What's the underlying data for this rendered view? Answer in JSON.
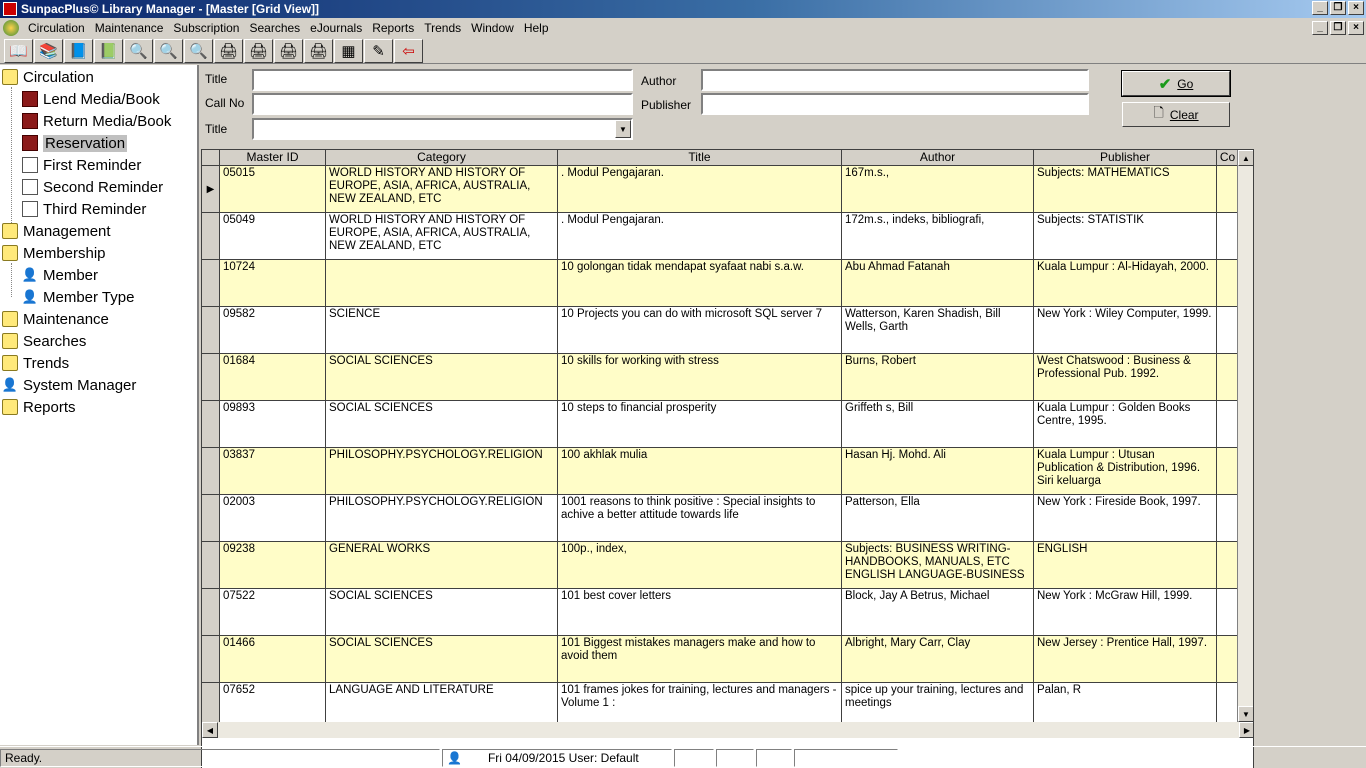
{
  "window": {
    "title": "SunpacPlus© Library Manager - [Master [Grid View]]"
  },
  "menu": [
    "Circulation",
    "Maintenance",
    "Subscription",
    "Searches",
    "eJournals",
    "Reports",
    "Trends",
    "Window",
    "Help"
  ],
  "toolbar_icons": [
    "lend-icon",
    "return-icon",
    "reservation-icon",
    "book-icon",
    "search-icon",
    "search-icon",
    "search-icon",
    "printer-icon",
    "printer-icon",
    "printer-icon",
    "printer-icon",
    "calculator-icon",
    "tools-icon",
    "exit-icon"
  ],
  "sidebar": {
    "items": [
      {
        "label": "Circulation",
        "icon": "folder"
      },
      {
        "label": "Lend Media/Book",
        "icon": "book"
      },
      {
        "label": "Return Media/Book",
        "icon": "book"
      },
      {
        "label": "Reservation",
        "icon": "book"
      },
      {
        "label": "First Reminder",
        "icon": "paper"
      },
      {
        "label": "Second Reminder",
        "icon": "paper"
      },
      {
        "label": "Third Reminder",
        "icon": "paper"
      },
      {
        "label": "Management",
        "icon": "folder"
      },
      {
        "label": "Membership",
        "icon": "folder"
      },
      {
        "label": "Member",
        "icon": "person"
      },
      {
        "label": "Member Type",
        "icon": "person"
      },
      {
        "label": "Maintenance",
        "icon": "folder"
      },
      {
        "label": "Searches",
        "icon": "folder"
      },
      {
        "label": "Trends",
        "icon": "folder"
      },
      {
        "label": "System Manager",
        "icon": "person"
      },
      {
        "label": "Reports",
        "icon": "folder"
      }
    ]
  },
  "search": {
    "title_label": "Title",
    "title_value": "",
    "callno_label": "Call No",
    "callno_value": "",
    "title2_label": "Title",
    "title2_value": "",
    "author_label": "Author",
    "author_value": "",
    "publisher_label": "Publisher",
    "publisher_value": "",
    "go_label": "Go",
    "clear_label": "Clear"
  },
  "grid": {
    "columns": [
      "Master ID",
      "Category",
      "Title",
      "Author",
      "Publisher",
      "Co"
    ],
    "rows": [
      [
        "05015",
        "WORLD HISTORY AND HISTORY OF EUROPE, ASIA, AFRICA, AUSTRALIA, NEW ZEALAND, ETC",
        ". Modul Pengajaran.",
        "167m.s.,",
        "Subjects: MATHEMATICS"
      ],
      [
        "05049",
        "WORLD HISTORY AND HISTORY OF EUROPE, ASIA, AFRICA, AUSTRALIA, NEW ZEALAND, ETC",
        ". Modul Pengajaran.",
        "172m.s., indeks, bibliografi,",
        "Subjects: STATISTIK"
      ],
      [
        "10724",
        "",
        "10 golongan tidak mendapat syafaat nabi s.a.w.",
        "Abu Ahmad Fatanah",
        "Kuala Lumpur : Al-Hidayah, 2000."
      ],
      [
        "09582",
        "SCIENCE",
        "10 Projects you can do with microsoft SQL server 7",
        "Watterson, Karen  Shadish, Bill  Wells, Garth",
        "New York : Wiley Computer, 1999."
      ],
      [
        "01684",
        "SOCIAL SCIENCES",
        "10 skills for working with stress",
        "Burns, Robert",
        "West Chatswood : Business & Professional Pub. 1992."
      ],
      [
        "09893",
        "SOCIAL SCIENCES",
        "10 steps to financial prosperity",
        "Griffeth s, Bill",
        "Kuala Lumpur : Golden Books Centre, 1995."
      ],
      [
        "03837",
        "PHILOSOPHY.PSYCHOLOGY.RELIGION",
        "100 akhlak mulia",
        "Hasan Hj. Mohd. Ali",
        "Kuala Lumpur : Utusan Publication & Distribution, 1996. Siri keluarga"
      ],
      [
        "02003",
        "PHILOSOPHY.PSYCHOLOGY.RELIGION",
        "1001 reasons to think positive : Special insights to achive a better attitude towards life",
        "Patterson, Ella",
        "New York : Fireside Book, 1997."
      ],
      [
        "09238",
        "GENERAL WORKS",
        "100p., index,",
        "Subjects: BUSINESS WRITING-HANDBOOKS, MANUALS, ETC  ENGLISH LANGUAGE-BUSINESS",
        "ENGLISH"
      ],
      [
        "07522",
        "SOCIAL SCIENCES",
        "101 best cover letters",
        "Block, Jay A  Betrus, Michael",
        "New York : McGraw Hill, 1999."
      ],
      [
        "01466",
        "SOCIAL SCIENCES",
        "101 Biggest mistakes managers make and how to avoid them",
        "Albright, Mary  Carr, Clay",
        "New Jersey : Prentice Hall, 1997."
      ],
      [
        "07652",
        "LANGUAGE AND LITERATURE",
        "101 frames jokes for training, lectures and managers - Volume 1 :",
        "spice up your training, lectures and meetings",
        "Palan, R"
      ]
    ]
  },
  "status": {
    "text": "Ready.",
    "datetime_user": "Fri 04/09/2015 User: Default"
  }
}
